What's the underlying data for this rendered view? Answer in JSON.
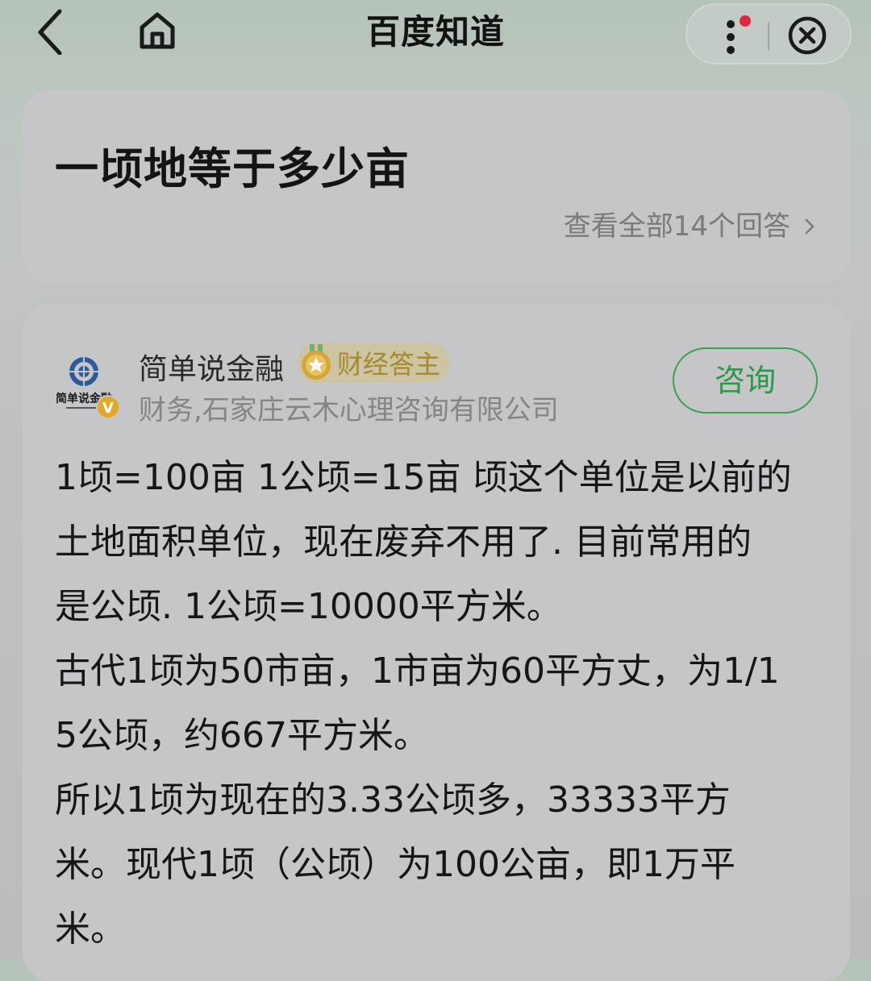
{
  "header": {
    "title": "百度知道",
    "back_icon": "chevron-left-icon",
    "home_icon": "home-icon",
    "more_icon": "more-vertical-icon",
    "close_icon": "close-circle-icon",
    "notification_dot_color": "#e0283a"
  },
  "question": {
    "title": "一顷地等于多少亩",
    "view_all_label": "查看全部14个回答"
  },
  "answer": {
    "author": {
      "name": "简单说金融",
      "badge_label": "财经答主",
      "org": "财务,石家庄云木心理咨询有限公司",
      "avatar_logo_text": "简单说金融",
      "verified_mark": "V"
    },
    "consult_label": "咨询",
    "lines": [
      "1顷=100亩 1公顷=15亩 顷这个单位是以前的",
      "土地面积单位，现在废弃不用了. 目前常用的",
      "是公顷. 1公顷=10000平方米。",
      "古代1顷为50市亩，1市亩为60平方丈，为1/1",
      "5公顷，约667平方米。",
      "所以1顷为现在的3.33公顷多，33333平方",
      "米。现代1顷（公顷）为100公亩，即1万平",
      "米。"
    ]
  },
  "colors": {
    "accent_green": "#2a9a48",
    "badge_gold": "#a68a2c"
  }
}
